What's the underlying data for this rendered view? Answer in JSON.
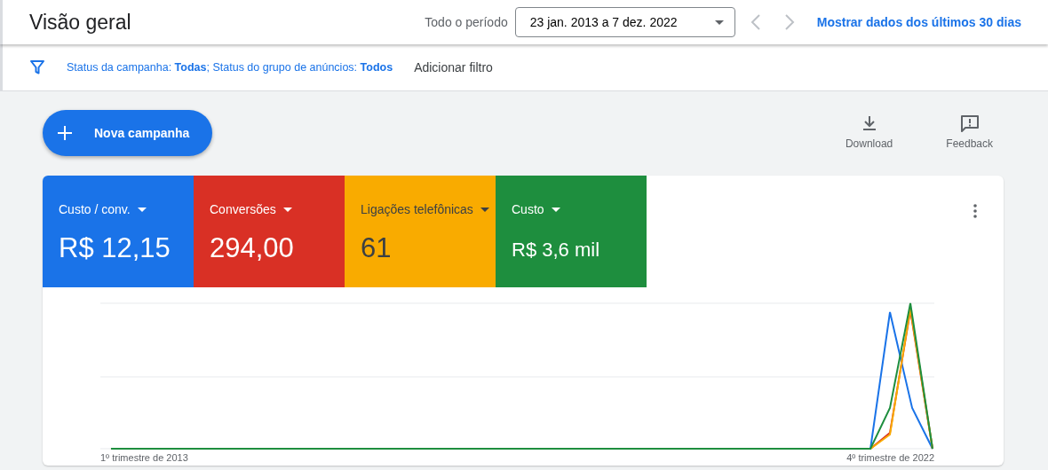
{
  "header": {
    "title": "Visão geral",
    "period_label": "Todo o período",
    "date_range": "23 jan. 2013 a 7 dez. 2022",
    "last_30_link": "Mostrar dados dos últimos 30 dias"
  },
  "filter_bar": {
    "filters": "Status da campanha: **Todas**; Status do grupo de anúncios: **Todos**",
    "add_filter": "Adicionar filtro"
  },
  "actions": {
    "new_campaign": "Nova campanha",
    "download": "Download",
    "feedback": "Feedback"
  },
  "metrics": [
    {
      "label": "Custo / conv.",
      "value": "R$ 12,15",
      "color": "#1a73e8"
    },
    {
      "label": "Conversões",
      "value": "294,00",
      "color": "#d93025"
    },
    {
      "label": "Ligações telefônicas",
      "value": "61",
      "color": "#f9ab00"
    },
    {
      "label": "Custo",
      "value": "R$ 3,6 mil",
      "color": "#1e8e3e"
    }
  ],
  "chart": {
    "x_start": "1º trimestre de 2013",
    "x_end": "4º trimestre de 2022"
  }
}
